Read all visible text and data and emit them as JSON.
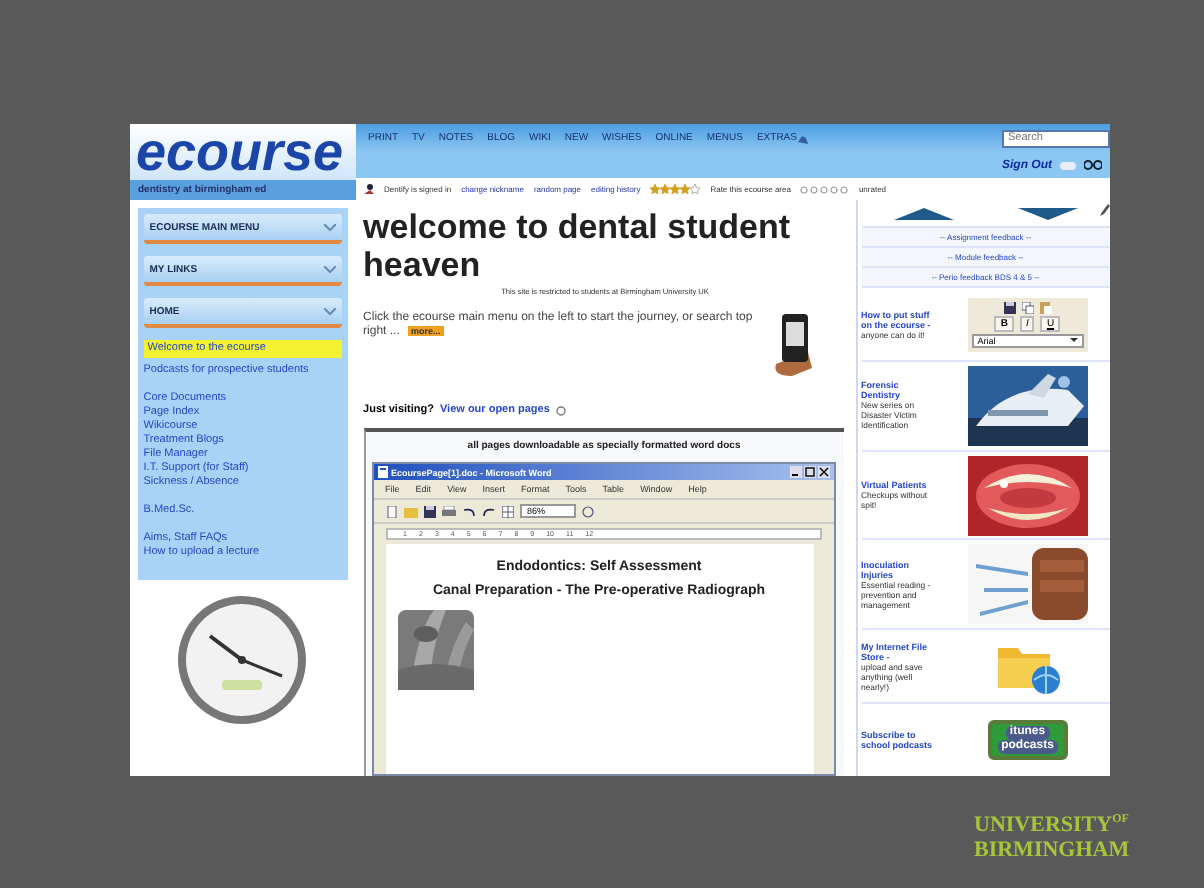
{
  "site": {
    "logo": "ecourse",
    "tagline": "dentistry at birmingham ed",
    "nav": [
      "PRINT",
      "TV",
      "NOTES",
      "BLOG",
      "WIKI",
      "NEW",
      "WISHES",
      "ONLINE",
      "MENUS",
      "EXTRAS"
    ],
    "search": {
      "placeholder": "Search"
    },
    "sign_out": "Sign Out",
    "status": {
      "user": "Dentify is signed in",
      "links": [
        "change nickname",
        "random page",
        "editing history"
      ],
      "stars": 4,
      "rate_label": "Rate this ecourse area",
      "rating": "unrated"
    }
  },
  "sidebar": {
    "menus": [
      {
        "label": "ECOURSE MAIN MENU"
      },
      {
        "label": "MY LINKS"
      },
      {
        "label": "HOME"
      }
    ],
    "groups": [
      [
        {
          "label": "Welcome to the ecourse",
          "selected": true
        },
        {
          "label": "Podcasts for prospective students",
          "selected": false
        }
      ],
      [
        {
          "label": "Core Documents",
          "selected": false
        },
        {
          "label": "Page Index",
          "selected": false
        },
        {
          "label": "Wikicourse",
          "selected": false
        },
        {
          "label": "Treatment Blogs",
          "selected": false
        },
        {
          "label": "File Manager",
          "selected": false
        },
        {
          "label": "I.T. Support (for Staff)",
          "selected": false
        },
        {
          "label": "Sickness / Absence",
          "selected": false
        }
      ],
      [
        {
          "label": "B.Med.Sc.",
          "selected": false
        }
      ],
      [
        {
          "label": "Aims, Staff FAQs",
          "selected": false
        },
        {
          "label": "How to upload a lecture",
          "selected": false
        }
      ]
    ]
  },
  "main": {
    "title": "welcome to dental student heaven",
    "notice": "This site is restricted to students at Birmingham University UK",
    "intro": "Click the ecourse main menu on the left to start the journey, or search top right ...",
    "more_button": "more...",
    "visiting_label": "Just visiting?",
    "visiting_link": "View our open pages",
    "downloads_caption": "all pages downloadable as specially formatted word docs",
    "word": {
      "title": "EcoursePage[1].doc - Microsoft Word",
      "menus": [
        "File",
        "Edit",
        "View",
        "Insert",
        "Format",
        "Tools",
        "Table",
        "Window",
        "Help"
      ],
      "zoom": "86%",
      "ruler": [
        "1",
        "2",
        "3",
        "4",
        "5",
        "6",
        "7",
        "8",
        "9",
        "10",
        "11",
        "12"
      ],
      "heading": "Endodontics: Self Assessment",
      "subheading": "Canal Preparation - The Pre-operative Radiograph"
    }
  },
  "right": {
    "feedback": [
      "-- Assignment feedback --",
      "-- Module feedback --",
      "-- Perio feedback BDS 4 & 5 --"
    ],
    "features": [
      {
        "kind": "editor",
        "title": "How to put stuff on the ecourse -",
        "text": "anyone can do it!",
        "format_buttons": [
          "B",
          "I",
          "U"
        ],
        "font": "Arial"
      },
      {
        "kind": "picture",
        "title": "Forensic Dentistry",
        "text": "New series on Disaster Victim Identification"
      },
      {
        "kind": "picture",
        "title": "Virtual Patients",
        "text": "Checkups without spit!"
      },
      {
        "kind": "picture",
        "title": "Inoculation Injuries",
        "text": "Essential reading - prevention and management"
      },
      {
        "kind": "folder",
        "title": "My Internet File Store -",
        "text": "upload and save anything (well nearly!)"
      },
      {
        "kind": "podcast",
        "title": "Subscribe to school podcasts",
        "badge": [
          "itunes",
          "podcasts"
        ]
      }
    ]
  },
  "slide": {
    "logo": [
      "UNIVERSITY$^{OF}$",
      "BIRMINGHAM"
    ]
  }
}
